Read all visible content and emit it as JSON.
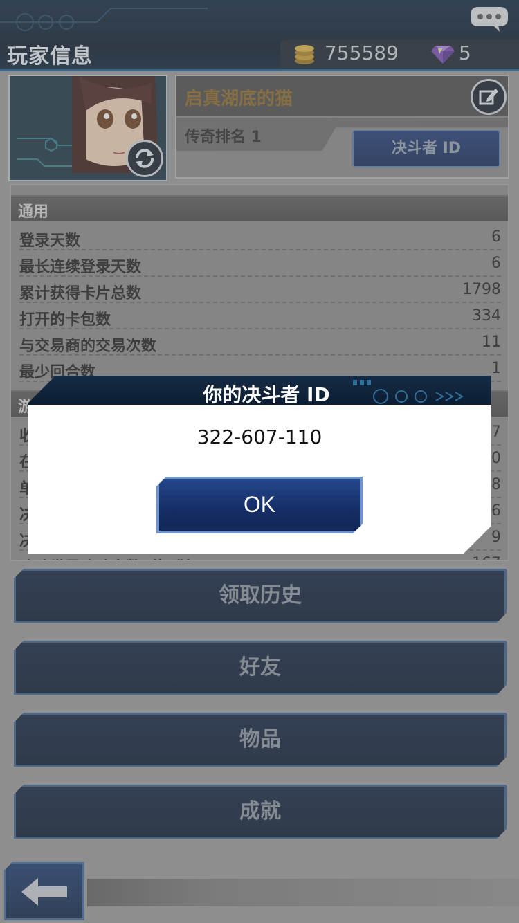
{
  "header": {
    "title": "玩家信息",
    "coins": "755589",
    "gems": "5"
  },
  "profile": {
    "name": "启真湖底的猫",
    "rank": "传奇排名 1",
    "duelist_id_button": "决斗者 ID"
  },
  "stats": {
    "general_header": "通用",
    "rows": [
      {
        "label": "登录天数",
        "value": "6"
      },
      {
        "label": "最长连续登录天数",
        "value": "6"
      },
      {
        "label": "累计获得卡片总数",
        "value": "1798"
      },
      {
        "label": "打开的卡包数",
        "value": "334"
      },
      {
        "label": "与交易商的交易次数",
        "value": "11"
      },
      {
        "label": "最少回合数",
        "value": "1"
      }
    ],
    "second_header": "游",
    "hidden_rows": [
      {
        "label": "收",
        "value": "7"
      },
      {
        "label": "在",
        "value": "0"
      },
      {
        "label": "单",
        "value": "8"
      },
      {
        "label": "决",
        "value": "6"
      },
      {
        "label": "决",
        "value": "9"
      },
      {
        "label": "决斗世界决斗次数（标准）",
        "value": "167"
      }
    ]
  },
  "menu": [
    {
      "label": "领取历史"
    },
    {
      "label": "好友"
    },
    {
      "label": "物品"
    },
    {
      "label": "成就"
    }
  ],
  "dialog": {
    "title": "你的决斗者 ID",
    "duelist_id": "322-607-110",
    "ok_label": "OK"
  },
  "colors": {
    "dialog_header": "#0c1d31",
    "button_blue": "#1b3a78",
    "name_gold": "#8f6a2a"
  }
}
